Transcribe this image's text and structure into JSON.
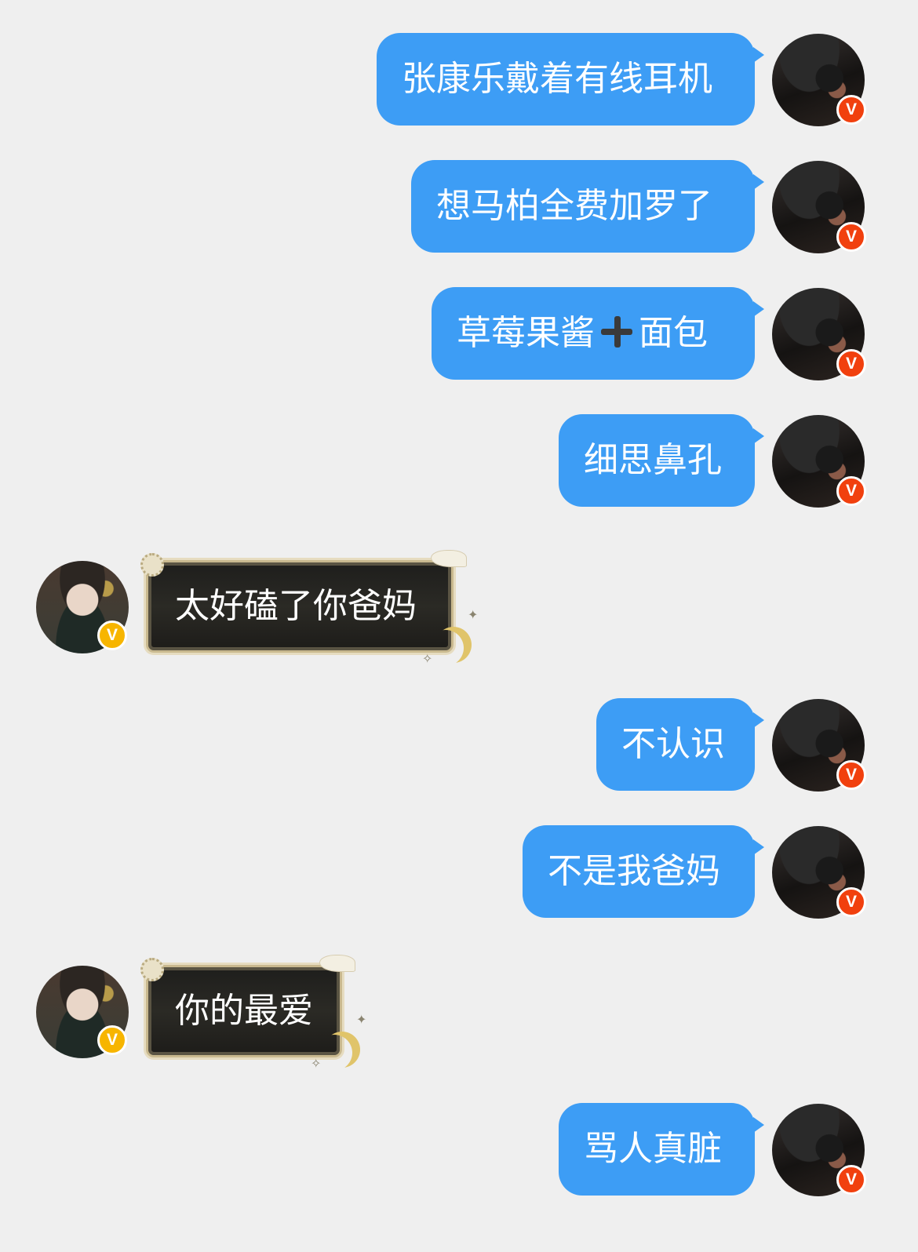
{
  "messages": [
    {
      "sender": "me",
      "text": "张康乐戴着有线耳机"
    },
    {
      "sender": "me",
      "text": "想马柏全费加罗了"
    },
    {
      "sender": "me",
      "text_before": "草莓果酱",
      "icon": "plus-icon",
      "text_after": "面包"
    },
    {
      "sender": "me",
      "text": "细思鼻孔"
    },
    {
      "sender": "other",
      "text": "太好磕了你爸妈"
    },
    {
      "sender": "me",
      "text": "不认识"
    },
    {
      "sender": "me",
      "text": "不是我爸妈"
    },
    {
      "sender": "other",
      "text": "你的最爱"
    },
    {
      "sender": "me",
      "text": "骂人真脏"
    }
  ],
  "badges": {
    "me": "V",
    "other": "V"
  },
  "colors": {
    "background": "#efefef",
    "me_bubble": "#3d9df5",
    "other_bubble": "#222120",
    "badge_me": "#f1400e",
    "badge_other": "#f7b500"
  }
}
